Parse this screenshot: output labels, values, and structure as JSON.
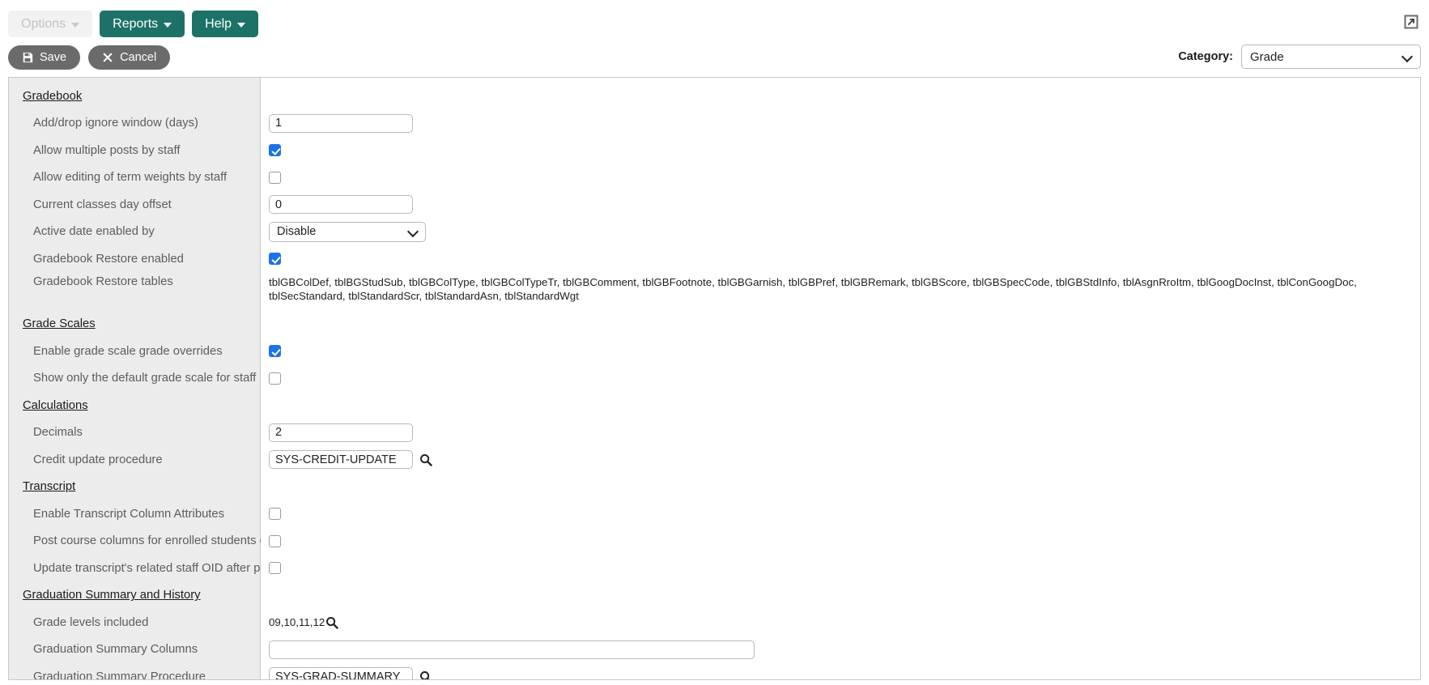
{
  "toolbar": {
    "options_label": "Options",
    "reports_label": "Reports",
    "help_label": "Help",
    "save_label": "Save",
    "cancel_label": "Cancel",
    "save_icon": "floppy-disk-icon",
    "cancel_icon": "x-mark-icon",
    "expand_icon": "expand-window-icon",
    "accent_color": "#1d7267",
    "pill_color": "#6b6b6b"
  },
  "category": {
    "label": "Category:",
    "value": "Grade",
    "options": [
      "Grade"
    ]
  },
  "groups": [
    {
      "heading": "Gradebook",
      "fields": [
        {
          "label": "Add/drop ignore window (days)",
          "type": "text",
          "value": "1"
        },
        {
          "label": "Allow multiple posts by staff",
          "type": "checkbox",
          "checked": true
        },
        {
          "label": "Allow editing of term weights by staff",
          "type": "checkbox",
          "checked": false
        },
        {
          "label": "Current classes day offset",
          "type": "text",
          "value": "0"
        },
        {
          "label": "Active date enabled by",
          "type": "select",
          "value": "Disable",
          "options": [
            "Disable"
          ]
        },
        {
          "label": "Gradebook Restore enabled",
          "type": "checkbox",
          "checked": true
        },
        {
          "label": "Gradebook Restore tables",
          "type": "static-long",
          "value": "tblGBColDef, tblBGStudSub, tblGBColType, tblGBColTypeTr, tblGBComment, tblGBFootnote, tblGBGarnish, tblGBPref, tblGBRemark, tblGBScore, tblGBSpecCode, tblGBStdInfo, tblAsgnRroItm, tblGoogDocInst, tblConGoogDoc, tblSecStandard, tblStandardScr, tblStandardAsn, tblStandardWgt"
        }
      ]
    },
    {
      "heading": "Grade Scales",
      "fields": [
        {
          "label": "Enable grade scale grade overrides",
          "type": "checkbox",
          "checked": true
        },
        {
          "label": "Show only the default grade scale for staff",
          "type": "checkbox",
          "checked": false
        }
      ]
    },
    {
      "heading": "Calculations",
      "fields": [
        {
          "label": "Decimals",
          "type": "text",
          "value": "2"
        },
        {
          "label": "Credit update procedure",
          "type": "text-lookup",
          "value": "SYS-CREDIT-UPDATE",
          "icon": "magnifier-icon"
        }
      ]
    },
    {
      "heading": "Transcript",
      "fields": [
        {
          "label": "Enable Transcript Column Attributes",
          "type": "checkbox",
          "checked": false
        },
        {
          "label": "Post course columns for enrolled students only",
          "type": "checkbox",
          "checked": false
        },
        {
          "label": "Update transcript's related staff OID after post",
          "type": "checkbox",
          "checked": false
        }
      ]
    },
    {
      "heading": "Graduation Summary and History",
      "fields": [
        {
          "label": "Grade levels included",
          "type": "static-lookup",
          "value": "09,10,11,12",
          "icon": "magnifier-icon"
        },
        {
          "label": "Graduation Summary Columns",
          "type": "text-wide",
          "value": "",
          "placeholder": ""
        },
        {
          "label": "Graduation Summary Procedure",
          "type": "text-lookup",
          "value": "SYS-GRAD-SUMMARY",
          "icon": "magnifier-icon"
        }
      ]
    }
  ]
}
